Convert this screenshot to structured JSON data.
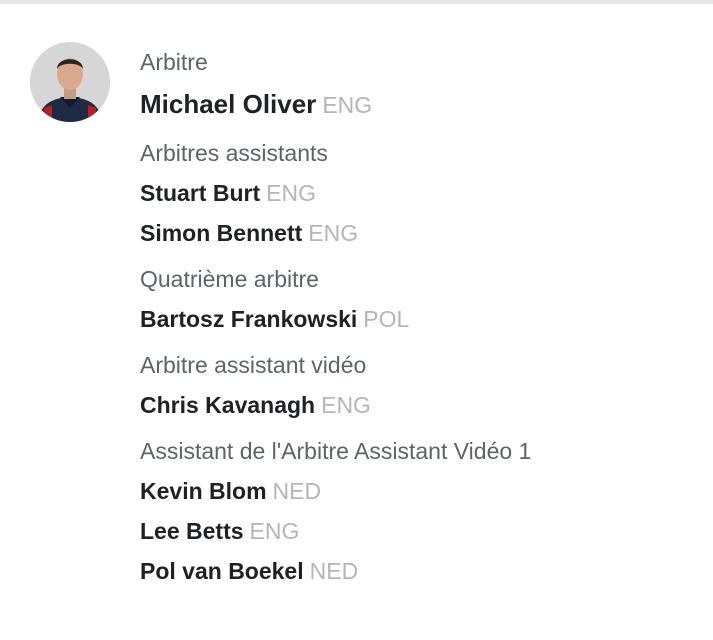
{
  "referee": {
    "role": "Arbitre",
    "name": "Michael Oliver",
    "nation": "ENG"
  },
  "groups": [
    {
      "role": "Arbitres assistants",
      "people": [
        {
          "name": "Stuart Burt",
          "nation": "ENG"
        },
        {
          "name": "Simon Bennett",
          "nation": "ENG"
        }
      ]
    },
    {
      "role": "Quatrième arbitre",
      "people": [
        {
          "name": "Bartosz Frankowski",
          "nation": "POL"
        }
      ]
    },
    {
      "role": "Arbitre assistant vidéo",
      "people": [
        {
          "name": "Chris Kavanagh",
          "nation": "ENG"
        }
      ]
    },
    {
      "role": "Assistant de l'Arbitre Assistant Vidéo 1",
      "people": [
        {
          "name": "Kevin Blom",
          "nation": "NED"
        },
        {
          "name": "Lee Betts",
          "nation": "ENG"
        },
        {
          "name": "Pol van Boekel",
          "nation": "NED"
        }
      ]
    }
  ]
}
